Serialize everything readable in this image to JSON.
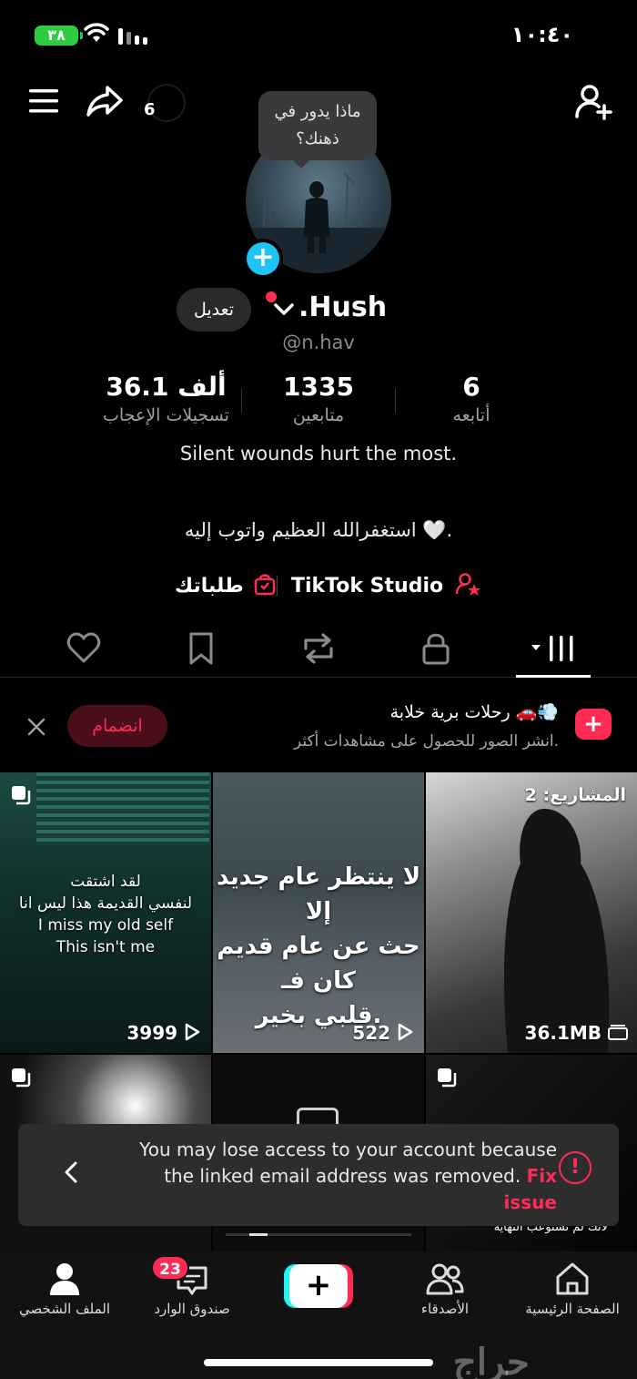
{
  "status": {
    "battery": "٣٨",
    "time": "١٠:٤٠"
  },
  "header": {
    "share_count": "6"
  },
  "profile": {
    "thought_bubble": "ماذا يدور في ذهنك؟",
    "edit_label": "تعديل",
    "display_name": ".Hush",
    "username": "@n.hav"
  },
  "stats": [
    {
      "value": "36.1 ألف",
      "label": "تسجيلات الإعجاب"
    },
    {
      "value": "1335",
      "label": "متابعين"
    },
    {
      "value": "6",
      "label": "أتابعه"
    }
  ],
  "bio": {
    "line1": "Silent wounds hurt the most.",
    "line2": "استغفرالله العظيم واتوب إليه 🤍."
  },
  "links": {
    "studio": "TikTok Studio",
    "orders": "طلباتك"
  },
  "banner": {
    "title": "رحلات برية خلابة 🚗💨",
    "subtitle": "انشر الصور للحصول على مشاهدات أكثر.",
    "join_label": "انضمام"
  },
  "grid": {
    "projects_label": "المشاريع: 2",
    "items": [
      {
        "text": "لقد اشتقت\nلنفسي القديمة هذا ليس انا\nI miss my old self\nThis isn't me",
        "count": "3999"
      },
      {
        "text": "لا ينتظر عام جديد إلا\nحث عن عام قديم كان فـ\nقلبي بخير.",
        "count": "522"
      },
      {
        "text": "",
        "count": "36.1MB"
      },
      {
        "text": "",
        "count": ""
      },
      {
        "text": "",
        "count": ""
      },
      {
        "text": "لانك لم تستوعب النهايه",
        "count": ""
      }
    ]
  },
  "toast": {
    "message": "You may lose access to your account because the linked email address was removed.",
    "action": "Fix issue"
  },
  "nav": {
    "profile": "الملف الشخصي",
    "inbox": "صندوق الوارد",
    "inbox_badge": "23",
    "friends": "الأصدقاء",
    "home": "الصفحة الرئيسية"
  },
  "watermark": "حراج",
  "colors": {
    "accent": "#fe2c55",
    "cyan": "#25f4ee",
    "plus_blue": "#20c4f4",
    "background": "#000000"
  }
}
